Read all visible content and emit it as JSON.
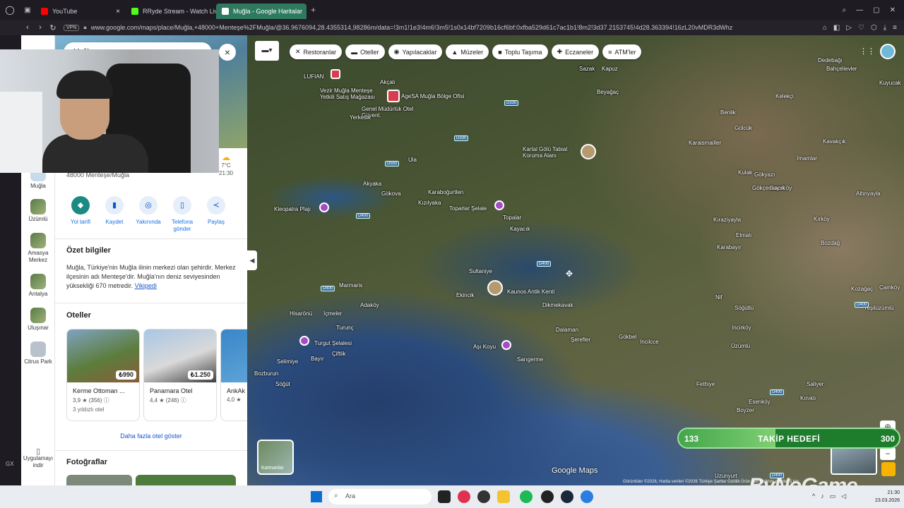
{
  "browser": {
    "tabs": [
      {
        "label": "YouTube",
        "color": "#ff0000"
      },
      {
        "label": "RRyde Stream - Watch Liv",
        "color": "#53fc18"
      },
      {
        "label": "Muğla - Google Haritalar",
        "color": "#34a853",
        "active": true
      }
    ],
    "vpn": "VPN",
    "url": "www.google.com/maps/place/Muğla,+48000+Menteşe%2FMuğla/@36.9676094,28.4355314,98286m/data=!3m1!1e3!4m6!3m5!1s0x14bf7209b16cf6bf:0xfba529d61c7ac1b1!8m2!3d37.2153745!4d28.363394!16zL20vMDR3dWhz"
  },
  "rail": {
    "items": [
      {
        "label": "Muğla"
      },
      {
        "label": "Üzümlü"
      },
      {
        "label": "Amasya Merkez"
      },
      {
        "label": "Antalya"
      },
      {
        "label": "Uluşınar"
      },
      {
        "label": "Citrus Park"
      }
    ],
    "install_label": "Uygulamayı indir"
  },
  "panel": {
    "search_value": "Muğla",
    "weather_temp": "7°C",
    "weather_time": "21:30",
    "address": "48000 Menteşe/Muğla",
    "actions": [
      {
        "label": "Yol tarifi",
        "icon": "◆"
      },
      {
        "label": "Kaydet",
        "icon": "▮"
      },
      {
        "label": "Yakınında",
        "icon": "◎"
      },
      {
        "label": "Telefona gönder",
        "icon": "▯"
      },
      {
        "label": "Paylaş",
        "icon": "≺"
      }
    ],
    "summary_title": "Özet bilgiler",
    "summary_text": "Muğla, Türkiye'nin Muğla ilinin merkezi olan şehirdir. Merkez ilçesinin adı Menteşe'dir. Muğla'nın deniz seviyesinden yüksekliği 670 metredir.",
    "summary_link": "Vikipedi",
    "hotels_title": "Oteller",
    "hotels": [
      {
        "name": "Kerme Ottoman ...",
        "price": "₺990",
        "rating": "3,9 ★ (356) ⓘ",
        "class": "3 yıldızlı otel"
      },
      {
        "name": "Panamara Otel",
        "price": "₺1.250",
        "rating": "4,4 ★ (246) ⓘ",
        "class": ""
      },
      {
        "name": "AnkAk",
        "price": "",
        "rating": "4,0 ★",
        "class": ""
      }
    ],
    "more_hotels": "Daha fazla otel göster",
    "photos_title": "Fotoğraflar"
  },
  "map": {
    "chips": [
      {
        "icon": "✕",
        "label": "Restoranlar"
      },
      {
        "icon": "▬",
        "label": "Oteller"
      },
      {
        "icon": "◉",
        "label": "Yapılacaklar"
      },
      {
        "icon": "▲",
        "label": "Müzeler"
      },
      {
        "icon": "■",
        "label": "Toplu Taşıma"
      },
      {
        "icon": "✚",
        "label": "Eczaneler"
      },
      {
        "icon": "≡",
        "label": "ATM'ler"
      }
    ],
    "places": [
      "Sazak",
      "Kapuz",
      "Beyağaç",
      "Dedebağı",
      "Bahçelievler",
      "Kuyucak",
      "Kelekçi",
      "Benlik",
      "Gölcük",
      "Kavakçık",
      "Karaismailler",
      "İmamlar",
      "Gökyazı",
      "Kulak",
      "Bayırköy",
      "Gökçeovacık",
      "Altınyayla",
      "Kırköy",
      "Kıraziyayla",
      "Elmalı",
      "Bozdağ",
      "Karabayır",
      "Nif",
      "Söğütlü",
      "İncirköy",
      "Akyaka",
      "Gökova",
      "Kızılyaka",
      "Karaboğurtlen",
      "Topalar",
      "Kayacık",
      "Toparlar Şelale",
      "Sultaniye",
      "Ekincik",
      "Kaunos Antik Kenti",
      "Dikmekavak",
      "Dalaman",
      "Şerefler",
      "Gökbel",
      "Incilcce",
      "Üzümlü",
      "Marmaris",
      "Adaköy",
      "Hisarönü",
      "İçmeler",
      "Turunç",
      "Turgut Şelalesi",
      "Çiftlik",
      "Bayır",
      "Selimiye",
      "Bozburun",
      "Söğüt",
      "Aşı Koyu",
      "Sarıgerme",
      "Fethiye",
      "Esenköy",
      "Boyzer",
      "Saliyer",
      "Kınıklı",
      "Yeşilüzümlü",
      "Uzunyurt",
      "Sazak",
      "Kartal Gölü Tabiat Koruma Alanı",
      "Kleopatra Plajı",
      "LUFIAN",
      "Vezir Muğla Menteşe Yetkili Satış Mağazası",
      "AgeSA Muğla Bölge Ofisi",
      "Genel Müdürlük Otel Güvenl.",
      "Yerkesik",
      "Ula",
      "Akçalı",
      "Kozağaç",
      "Çamköy"
    ],
    "roads": [
      "D330",
      "D330",
      "D550",
      "D400",
      "D400",
      "D400",
      "D400",
      "D400",
      "D400"
    ],
    "layers_label": "Katmanlar",
    "brand": "Google Maps",
    "attribution": "Görüntüler ©2026, Harita verileri ©2026   Türkiye   Şartlar   Gizlilik   Ürün geri bildirimi gönder   5 km"
  },
  "overlay": {
    "follow_current": "133",
    "follow_label": "TAKİP HEDEFİ",
    "follow_goal": "300",
    "follow_progress": 0.44,
    "watermark": "ByNoGame"
  },
  "taskbar": {
    "search_placeholder": "Ara",
    "time": "21:30",
    "date": "23.03.2026"
  }
}
